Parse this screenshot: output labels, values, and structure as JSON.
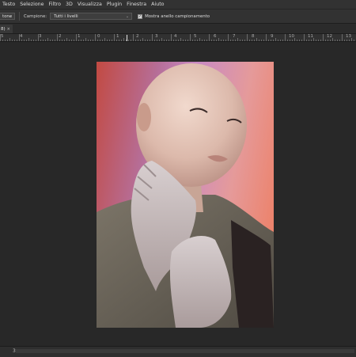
{
  "menubar": {
    "items": [
      "Testo",
      "Selezione",
      "Filtro",
      "3D",
      "Visualizza",
      "Plugin",
      "Finestra",
      "Aiuto"
    ]
  },
  "options": {
    "tool_partial_label": "tone",
    "sample_label": "Campione:",
    "sample_value": "Tutti i livelli",
    "show_ring_label": "Mostra anello campionamento"
  },
  "tab": {
    "label": "8)"
  },
  "ruler": {
    "labels": [
      "5",
      "4",
      "3",
      "2",
      "1",
      "0",
      "1",
      "2",
      "3",
      "4",
      "5",
      "6",
      "7",
      "8",
      "9",
      "10",
      "11",
      "12",
      "13"
    ]
  },
  "status": {
    "left_text": "3"
  },
  "colors": {
    "ui_background": "#282828",
    "panel": "#323232"
  }
}
